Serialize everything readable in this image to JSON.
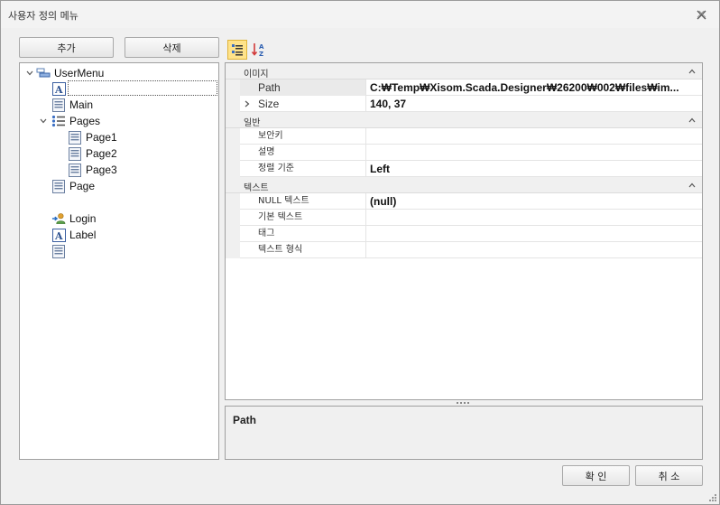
{
  "window": {
    "title": "사용자 정의 메뉴"
  },
  "buttons": {
    "add": "추가",
    "delete": "삭제",
    "ok": "확 인",
    "cancel": "취 소"
  },
  "tree": {
    "root": "UserMenu",
    "items": [
      {
        "label": "",
        "icon": "text-a-icon"
      },
      {
        "label": "Main",
        "icon": "page-icon"
      },
      {
        "label": "Pages",
        "icon": "list-icon"
      },
      {
        "label": "Page1",
        "icon": "page-icon"
      },
      {
        "label": "Page2",
        "icon": "page-icon"
      },
      {
        "label": "Page3",
        "icon": "page-icon"
      },
      {
        "label": "Page",
        "icon": "page-icon"
      },
      {
        "label": "Login",
        "icon": "login-icon"
      },
      {
        "label": "Label",
        "icon": "text-a-icon"
      },
      {
        "label": "",
        "icon": "page-icon"
      }
    ]
  },
  "grid": {
    "categories": [
      {
        "label": "이미지",
        "rows": [
          {
            "name": "Path",
            "value": "C:₩Temp₩Xisom.Scada.Designer₩26200₩002₩files₩im..."
          },
          {
            "name": "Size",
            "value": "140, 37"
          }
        ]
      },
      {
        "label": "일반",
        "rows": [
          {
            "name": "보안키",
            "value": ""
          },
          {
            "name": "설명",
            "value": ""
          },
          {
            "name": "정렬 기준",
            "value": "Left"
          }
        ]
      },
      {
        "label": "텍스트",
        "rows": [
          {
            "name": "NULL 텍스트",
            "value": "(null)"
          },
          {
            "name": "기본 텍스트",
            "value": ""
          },
          {
            "name": "태그",
            "value": ""
          },
          {
            "name": "텍스트 형식",
            "value": ""
          }
        ]
      }
    ]
  },
  "description": {
    "title": "Path"
  }
}
